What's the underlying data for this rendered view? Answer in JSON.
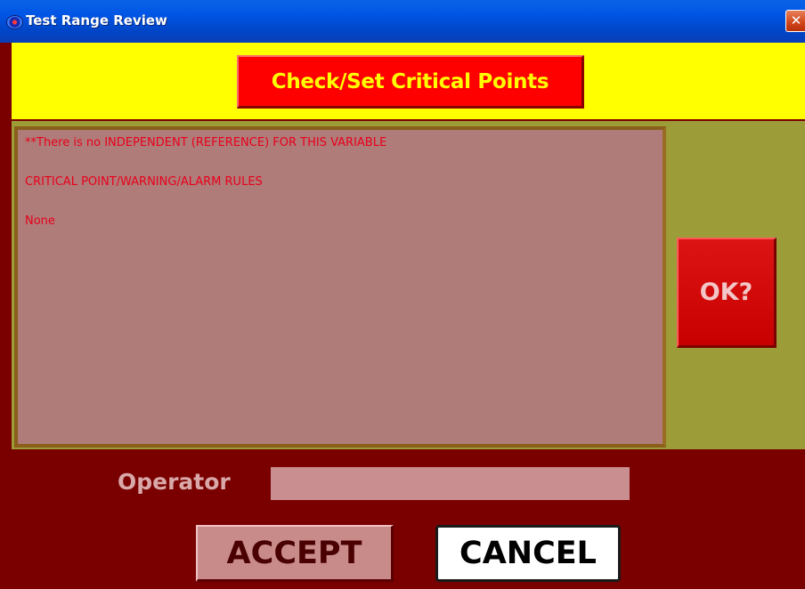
{
  "window": {
    "title": "Test Range Review",
    "icon": "app-globe-icon",
    "close_glyph": "✕"
  },
  "header": {
    "critical_points_button": "Check/Set Critical Points"
  },
  "info": {
    "lines": [
      "**There is no INDEPENDENT (REFERENCE) FOR THIS VARIABLE",
      "CRITICAL POINT/WARNING/ALARM RULES",
      "None"
    ]
  },
  "ok_button": "OK?",
  "operator": {
    "label": "Operator",
    "value": ""
  },
  "actions": {
    "accept": "ACCEPT",
    "cancel": "CANCEL"
  },
  "colors": {
    "titlebar": "#0055e5",
    "header_band": "#ffff00",
    "primary_button": "#ff0000",
    "panel": "#9c9c38",
    "info_box": "#b07c7a",
    "info_text": "#e8001a",
    "footer": "#7a0000"
  }
}
